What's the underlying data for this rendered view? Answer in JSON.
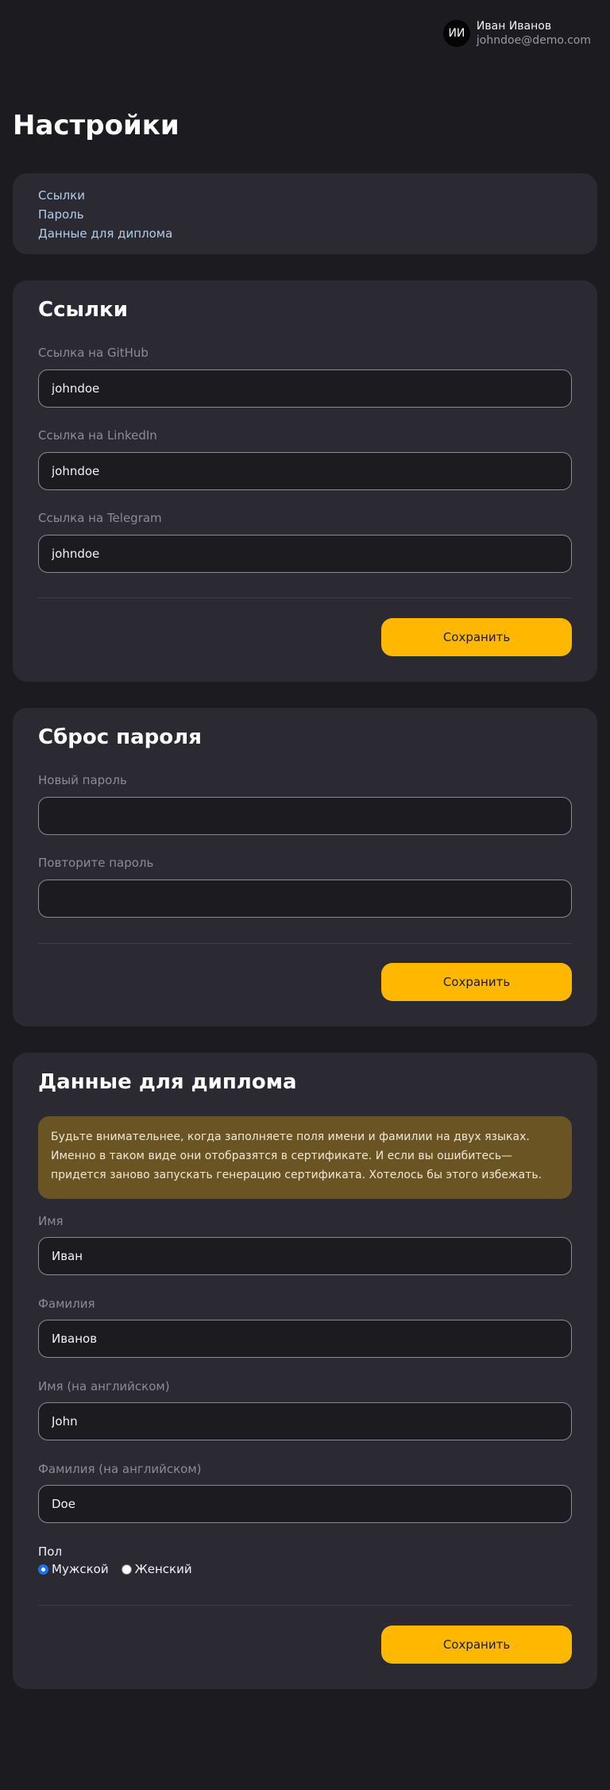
{
  "user": {
    "initials": "ИИ",
    "name": "Иван Иванов",
    "email": "johndoe@demo.com"
  },
  "page": {
    "title": "Настройки"
  },
  "nav": {
    "items": [
      "Ссылки",
      "Пароль",
      "Данные для диплома"
    ]
  },
  "links": {
    "title": "Ссылки",
    "github_label": "Ссылка на GitHub",
    "github_value": "johndoe",
    "linkedin_label": "Ссылка на LinkedIn",
    "linkedin_value": "johndoe",
    "telegram_label": "Ссылка на Telegram",
    "telegram_value": "johndoe",
    "save_label": "Сохранить"
  },
  "password": {
    "title": "Сброс пароля",
    "new_label": "Новый пароль",
    "new_value": "",
    "repeat_label": "Повторите пароль",
    "repeat_value": "",
    "save_label": "Сохранить"
  },
  "diploma": {
    "title": "Данные для диплома",
    "notice_lines": [
      "Будьте внимательнее, когда заполняете поля имени и фамилии на двух языках.",
      "Именно в таком виде они отобразятся в сертификате. И если вы ошибитесь—",
      "придется заново запускать генерацию сертификата. Хотелось бы этого избежать."
    ],
    "first_name_label": "Имя",
    "first_name_value": "Иван",
    "last_name_label": "Фамилия",
    "last_name_value": "Иванов",
    "first_name_en_label": "Имя (на английском)",
    "first_name_en_value": "John",
    "last_name_en_label": "Фамилия (на английском)",
    "last_name_en_value": "Doe",
    "gender_label": "Пол",
    "gender_options": [
      "Мужской",
      "Женский"
    ],
    "gender_selected": "Мужской",
    "save_label": "Сохранить"
  },
  "colors": {
    "background": "#1c1b20",
    "card": "#2b2a33",
    "accent": "#ffb700",
    "notice": "#6b5424",
    "link": "#b4cde6"
  }
}
